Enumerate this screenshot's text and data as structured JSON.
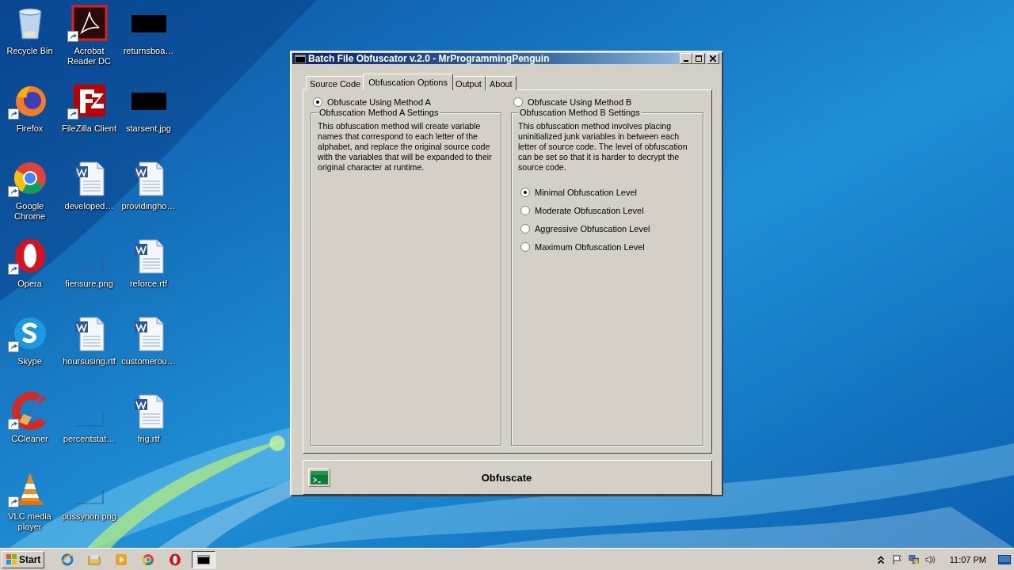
{
  "desktop": {
    "icons": [
      {
        "label": "Recycle Bin",
        "kind": "recycle",
        "shortcut": false
      },
      {
        "label": "Firefox",
        "kind": "firefox",
        "shortcut": true
      },
      {
        "label": "Google Chrome",
        "kind": "chrome",
        "shortcut": true
      },
      {
        "label": "Opera",
        "kind": "opera",
        "shortcut": true
      },
      {
        "label": "Skype",
        "kind": "skype",
        "shortcut": true
      },
      {
        "label": "CCleaner",
        "kind": "ccleaner",
        "shortcut": true
      },
      {
        "label": "VLC media player",
        "kind": "vlc",
        "shortcut": true
      },
      {
        "label": "Acrobat Reader DC",
        "kind": "acrobat",
        "shortcut": true
      },
      {
        "label": "FileZilla Client",
        "kind": "filezilla",
        "shortcut": true
      },
      {
        "label": "developed…",
        "kind": "word",
        "shortcut": false
      },
      {
        "label": "fiensure.png",
        "kind": "blank-image",
        "shortcut": false
      },
      {
        "label": "hoursusing.rtf",
        "kind": "word",
        "shortcut": false
      },
      {
        "label": "percentstat…",
        "kind": "blank-image",
        "shortcut": false
      },
      {
        "label": "pussynon.png",
        "kind": "blank-image",
        "shortcut": false
      },
      {
        "label": "returnsboa…",
        "kind": "dark-image",
        "shortcut": false
      },
      {
        "label": "starsent.jpg",
        "kind": "dark-image",
        "shortcut": false
      },
      {
        "label": "providingho…",
        "kind": "word",
        "shortcut": false
      },
      {
        "label": "reforce.rtf",
        "kind": "word",
        "shortcut": false
      },
      {
        "label": "customerou…",
        "kind": "word",
        "shortcut": false
      },
      {
        "label": "frig.rtf",
        "kind": "word",
        "shortcut": false
      }
    ]
  },
  "window": {
    "title": "Batch File Obfuscator v.2.0 - MrProgrammingPenguin",
    "tabs": [
      {
        "label": "Source Code",
        "selected": false
      },
      {
        "label": "Obfuscation Options",
        "selected": true
      },
      {
        "label": "Output",
        "selected": false
      },
      {
        "label": "About",
        "selected": false
      }
    ],
    "methods": [
      {
        "label": "Obfuscate Using Method A",
        "selected": true,
        "group_title": "Obfuscation Method A Settings",
        "description": "This obfuscation method will create variable names that correspond to each letter of the alphabet, and replace the original source code with the variables that will be expanded to their original character at runtime."
      },
      {
        "label": "Obfuscate Using Method B",
        "selected": false,
        "group_title": "Obfuscation Method B Settings",
        "description": "This obfuscation method involves placing uninitialized junk variables in between each letter of source code. The level of obfuscation can be set so that it is harder to decrypt the source code.",
        "levels": [
          {
            "label": "Minimal Obfuscation Level",
            "selected": true
          },
          {
            "label": "Moderate Obfuscation Level",
            "selected": false
          },
          {
            "label": "Aggressive Obfuscation Level",
            "selected": false
          },
          {
            "label": "Maximum Obfuscation Level",
            "selected": false
          }
        ]
      }
    ],
    "action_button": "Obfuscate"
  },
  "taskbar": {
    "start": "Start",
    "apps": [
      {
        "kind": "ie",
        "active": false
      },
      {
        "kind": "explorer",
        "active": false
      },
      {
        "kind": "media",
        "active": false
      },
      {
        "kind": "chrome",
        "active": false
      },
      {
        "kind": "opera",
        "active": false
      },
      {
        "kind": "console",
        "active": true
      }
    ],
    "clock": "11:07 PM"
  }
}
